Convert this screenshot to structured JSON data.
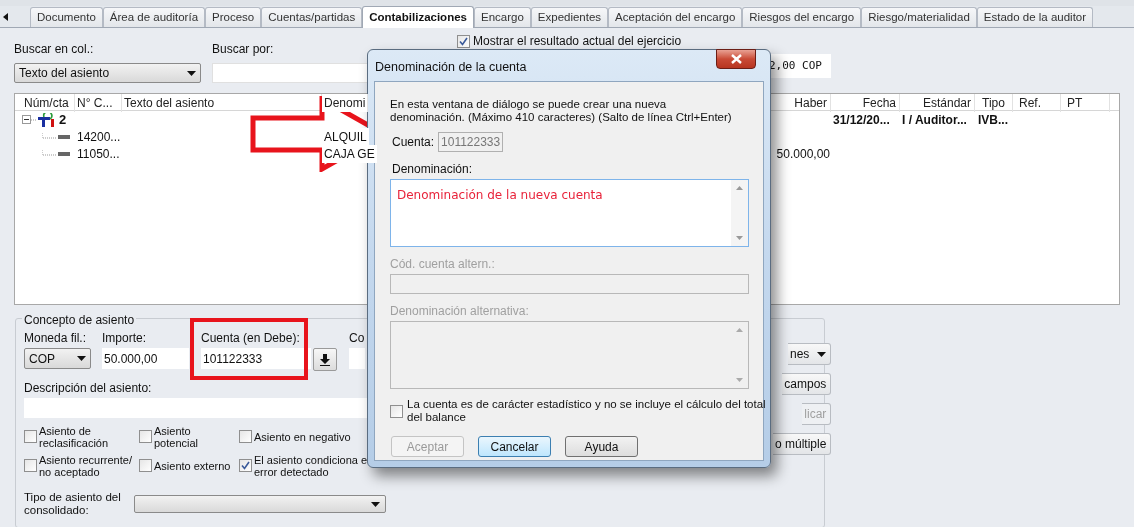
{
  "tabs": [
    {
      "label": "Documento",
      "selected": false
    },
    {
      "label": "Área de auditoría",
      "selected": false
    },
    {
      "label": "Proceso",
      "selected": false
    },
    {
      "label": "Cuentas/partidas",
      "selected": false
    },
    {
      "label": "Contabilizaciones",
      "selected": true
    },
    {
      "label": "Encargo",
      "selected": false
    },
    {
      "label": "Expedientes",
      "selected": false
    },
    {
      "label": "Aceptación del encargo",
      "selected": false
    },
    {
      "label": "Riesgos del encargo",
      "selected": false
    },
    {
      "label": "Riesgo/materialidad",
      "selected": false
    },
    {
      "label": "Estado de la auditor",
      "selected": false
    }
  ],
  "search": {
    "column_label": "Buscar en col.:",
    "column_value": "Texto del asiento",
    "search_label": "Buscar por:",
    "show_result": {
      "label": "Mostrar el resultado actual del ejercicio",
      "checked": true
    },
    "total": "2,00 COP"
  },
  "table": {
    "columns_left": [
      "Núm/cta",
      "N° C...",
      "Texto del asiento",
      "Denomi"
    ],
    "columns_right": [
      "Haber",
      "Fecha",
      "Estándar",
      "Tipo",
      "Ref.",
      "PT"
    ],
    "rows": [
      {
        "kind": "group",
        "expanded": true,
        "num": "2",
        "fecha": "31/12/20...",
        "estandar": "I / Auditor...",
        "tipo": "IVB..."
      },
      {
        "kind": "entry",
        "cuenta": "14200...",
        "denom": "ALQUIL"
      },
      {
        "kind": "entry",
        "cuenta": "11050...",
        "denom": "CAJA GE",
        "haber": "50.000,00"
      }
    ]
  },
  "concept": {
    "title": "Concepto de asiento",
    "currency_label": "Moneda fil.:",
    "currency": "COP",
    "amount_label": "Importe:",
    "amount": "50.000,00",
    "account_label": "Cuenta (en Debe):",
    "account": "101122333",
    "other_label": "Co",
    "description_label": "Descripción del asiento:",
    "flags": [
      {
        "lines": [
          "Asiento de",
          "reclasificación"
        ],
        "checked": false
      },
      {
        "lines": [
          "Asiento",
          "potencial"
        ],
        "checked": false
      },
      {
        "lines": [
          "Asiento en negativo"
        ],
        "checked": false
      },
      {
        "lines": [
          "Asiento recurrente/",
          "no aceptado"
        ],
        "checked": false
      },
      {
        "lines": [
          "Asiento externo"
        ],
        "checked": false
      },
      {
        "lines": [
          "El asiento condiciona e",
          "error detectado"
        ],
        "checked": true
      }
    ],
    "type_label": [
      "Tipo de asiento del",
      "consolidado:"
    ],
    "side_buttons": [
      {
        "label": "nes",
        "kind": "menu",
        "disabled": false
      },
      {
        "label": "campos",
        "kind": "plain",
        "disabled": false
      },
      {
        "label": "licar",
        "kind": "plain",
        "disabled": true
      },
      {
        "label": "o múltiple",
        "kind": "plain",
        "disabled": false
      }
    ]
  },
  "dialog": {
    "title": "Denominación de la cuenta",
    "intro": [
      "En esta ventana de diálogo se puede crear una nueva",
      "denominación. (Máximo 410 caracteres) (Salto de línea Ctrl+Enter)"
    ],
    "account_label": "Cuenta:",
    "account": "101122333",
    "name_label": "Denominación:",
    "name_value": "Denominación de la nueva cuenta",
    "alt_code_label": "Cód. cuenta altern.:",
    "alt_name_label": "Denominación alternativa:",
    "alt_disabled": true,
    "statistical": {
      "lines": [
        "La cuenta es de carácter estadístico y no se incluye el cálculo del total",
        "del balance"
      ],
      "checked": false
    },
    "buttons": [
      {
        "label": "Aceptar",
        "disabled": true,
        "focused": false
      },
      {
        "label": "Cancelar",
        "disabled": false,
        "focused": true
      },
      {
        "label": "Ayuda",
        "disabled": false,
        "focused": false
      }
    ]
  }
}
